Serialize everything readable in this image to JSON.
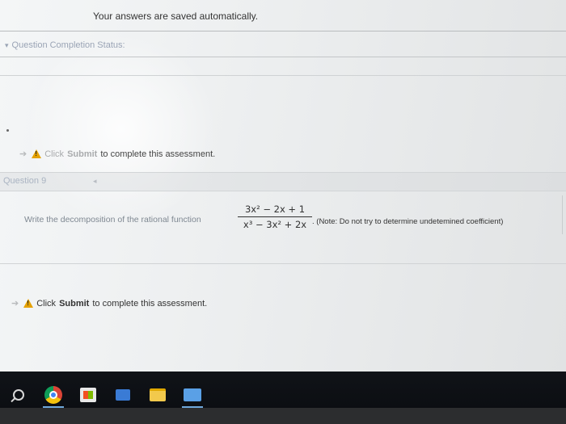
{
  "header": {
    "saved_message": "Your answers are saved automatically."
  },
  "completion_status": {
    "label": "Question Completion Status:",
    "toggle_icon": "chevron-down-icon"
  },
  "submit_notice_top": {
    "prefix": "Click",
    "action": "Submit",
    "suffix": "to complete this assessment."
  },
  "question": {
    "title": "Question 9",
    "prompt": "Write the decomposition of the rational function",
    "numerator": "3x² − 2x + 1",
    "denominator": "x³ − 3x² + 2x",
    "note": ". (Note: Do not try to determine undetemined coefficient)"
  },
  "submit_notice_bottom": {
    "prefix": "Click",
    "action": "Submit",
    "suffix": "to complete this assessment."
  },
  "taskbar": {
    "icons": [
      "search-icon",
      "chrome-icon",
      "store-icon",
      "mail-icon",
      "file-explorer-icon",
      "app-icon"
    ]
  },
  "colors": {
    "warning": "#e5a100",
    "taskbar": "#0a0c10",
    "accent": "#6fa8dc"
  }
}
